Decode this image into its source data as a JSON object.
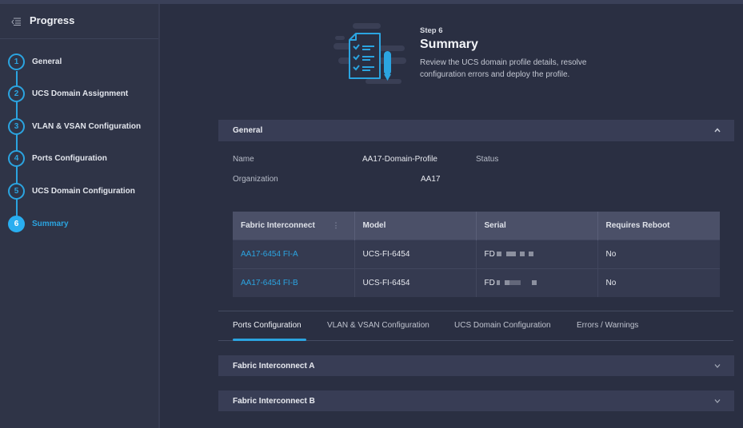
{
  "sidebar": {
    "title": "Progress",
    "menu_icon": "collapse-menu-icon",
    "steps": [
      {
        "number": "1",
        "label": "General",
        "active": false
      },
      {
        "number": "2",
        "label": "UCS Domain Assignment",
        "active": false
      },
      {
        "number": "3",
        "label": "VLAN & VSAN Configuration",
        "active": false
      },
      {
        "number": "4",
        "label": "Ports Configuration",
        "active": false
      },
      {
        "number": "5",
        "label": "UCS Domain Configuration",
        "active": false
      },
      {
        "number": "6",
        "label": "Summary",
        "active": true
      }
    ]
  },
  "hero": {
    "icon": "checklist-document-icon",
    "step": "Step 6",
    "title": "Summary",
    "description": "Review the UCS domain profile details, resolve configuration errors and deploy the profile."
  },
  "general": {
    "title": "General",
    "expanded": true,
    "fields": {
      "name_label": "Name",
      "name_value": "AA17-Domain-Profile",
      "status_label": "Status",
      "organization_label": "Organization",
      "organization_value": "AA17"
    }
  },
  "table": {
    "columns": [
      "Fabric Interconnect",
      "Model",
      "Serial",
      "Requires Reboot"
    ],
    "rows": [
      {
        "fabric_interconnect": "AA17-6454 FI-A",
        "model": "UCS-FI-6454",
        "serial_prefix": "FD",
        "requires_reboot": "No"
      },
      {
        "fabric_interconnect": "AA17-6454 FI-B",
        "model": "UCS-FI-6454",
        "serial_prefix": "FD",
        "requires_reboot": "No"
      }
    ]
  },
  "tabs": [
    {
      "label": "Ports Configuration",
      "active": true
    },
    {
      "label": "VLAN & VSAN Configuration",
      "active": false
    },
    {
      "label": "UCS Domain Configuration",
      "active": false
    },
    {
      "label": "Errors / Warnings",
      "active": false
    }
  ],
  "accordions": [
    {
      "label": "Fabric Interconnect A",
      "expanded": false
    },
    {
      "label": "Fabric Interconnect B",
      "expanded": false
    }
  ],
  "colors": {
    "accent": "#2ba4e0",
    "background": "#2a2f42",
    "sidebar": "#2f3447",
    "section_header": "#383d55"
  }
}
